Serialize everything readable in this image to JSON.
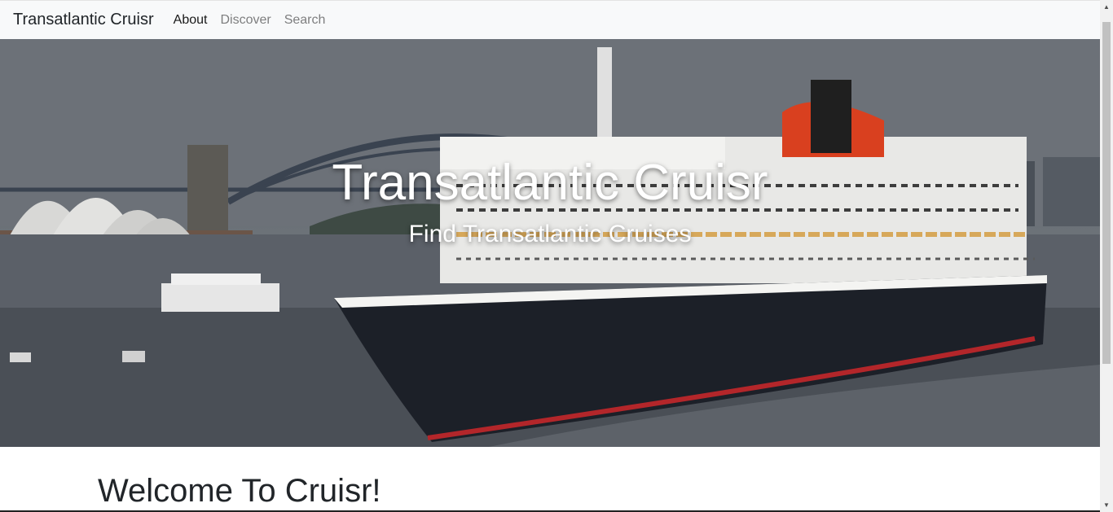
{
  "navbar": {
    "brand": "Transatlantic Cruisr",
    "links": [
      {
        "label": "About",
        "active": true
      },
      {
        "label": "Discover",
        "active": false
      },
      {
        "label": "Search",
        "active": false
      }
    ]
  },
  "hero": {
    "title": "Transatlantic Cruisr",
    "subtitle": "Find Transatlantic Cruises"
  },
  "main": {
    "heading": "Welcome To Cruisr!"
  },
  "colors": {
    "navbar_bg": "#f8f9fa",
    "hull": "#1c2028",
    "funnel": "#d9401f",
    "waterline": "#b3262a"
  }
}
